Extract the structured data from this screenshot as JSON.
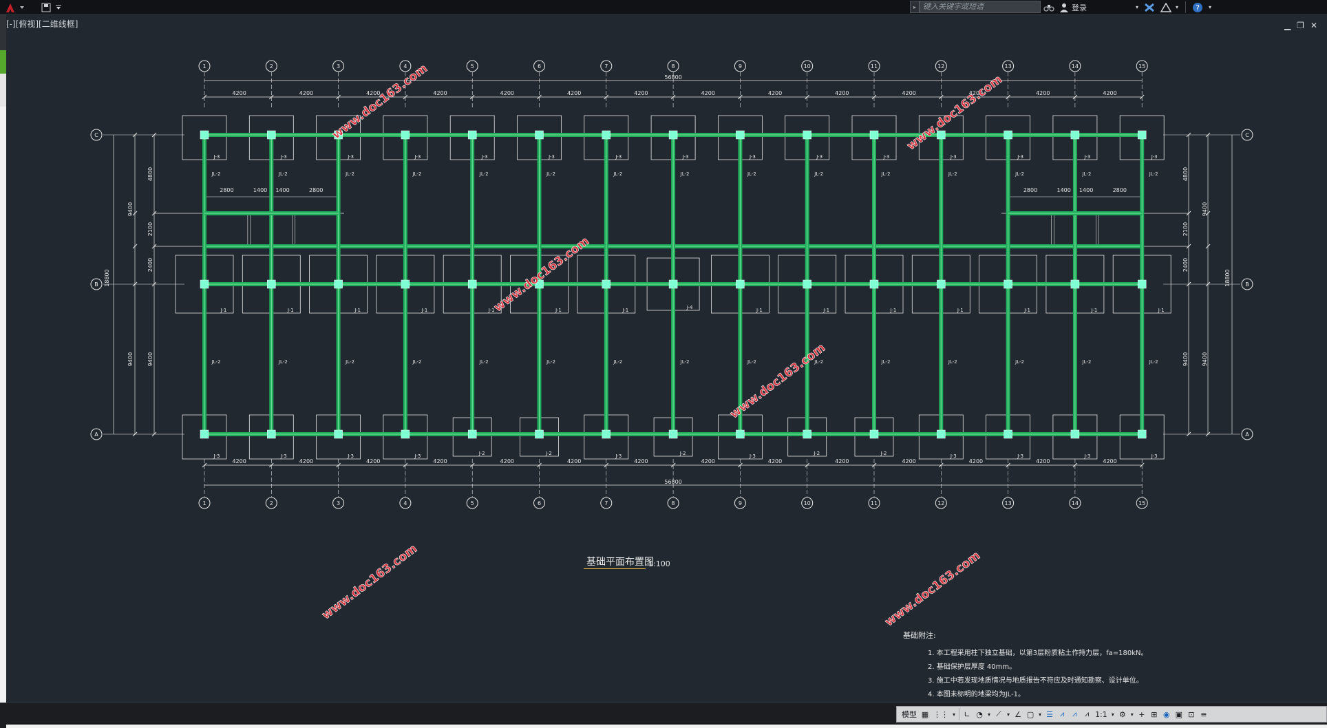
{
  "app": {
    "search_placeholder": "键入关键字或短语",
    "login_label": "登录",
    "viewport_label": "[-][俯视][二维线框]"
  },
  "drawing": {
    "title": "基础平面布置图",
    "scale": "1:100",
    "grid_columns": [
      "1",
      "2",
      "3",
      "4",
      "5",
      "6",
      "7",
      "8",
      "9",
      "10",
      "11",
      "12",
      "13",
      "14",
      "15"
    ],
    "grid_rows": [
      "C",
      "B",
      "A"
    ],
    "bay_dimension": "4200",
    "total_length": "56800",
    "total_width_left": "18800",
    "total_width_right": "18800",
    "left_dims": [
      "4800",
      "2100",
      "2400",
      "9400"
    ],
    "left_outer_dims": [
      "9400",
      "9400"
    ],
    "corridor_dims": [
      "2800",
      "1400",
      "1400",
      "2800"
    ],
    "beam_labels": [
      "JL-2"
    ],
    "footing_labels": {
      "row_c": [
        "J-3",
        "J-3",
        "J-3",
        "J-3",
        "J-3",
        "J-3",
        "J-3",
        "J-3",
        "J-3",
        "J-3",
        "J-3",
        "J-3",
        "J-3",
        "J-3",
        "J-3"
      ],
      "row_b": [
        "J-1",
        "J-1",
        "J-1",
        "J-1",
        "J-1",
        "J-1",
        "J-1",
        "J-4",
        "J-1",
        "J-1",
        "J-1",
        "J-1",
        "J-1",
        "J-1",
        "J-1"
      ],
      "row_a": [
        "J-3",
        "J-3",
        "J-3",
        "J-3",
        "J-2",
        "J-2",
        "J-3",
        "J-2",
        "J-3",
        "J-2",
        "J-2",
        "J-3",
        "J-3",
        "J-3",
        "J-3"
      ]
    },
    "watermark": "www.doc163.com",
    "notes_title": "基础附注:",
    "notes": [
      "1. 本工程采用柱下独立基础，以第3层粉质粘土作持力层，fa=180kN。",
      "2. 基础保护层厚度 40mm。",
      "3. 施工中若发现地质情况与地质报告不符应及时通知勘察、设计单位。",
      "4. 本图未标明的地梁均为JL-1。"
    ]
  },
  "statusbar": {
    "model_label": "模型",
    "scale_label": "1:1"
  },
  "colors": {
    "background": "#212830",
    "beam_green": "#1fae5c",
    "beam_inner": "#7fe39f",
    "column_cyan": "#7fffd4",
    "line_white": "#e8e8e8",
    "watermark_red": "#d8323c",
    "title_underline": "#e3b341"
  }
}
